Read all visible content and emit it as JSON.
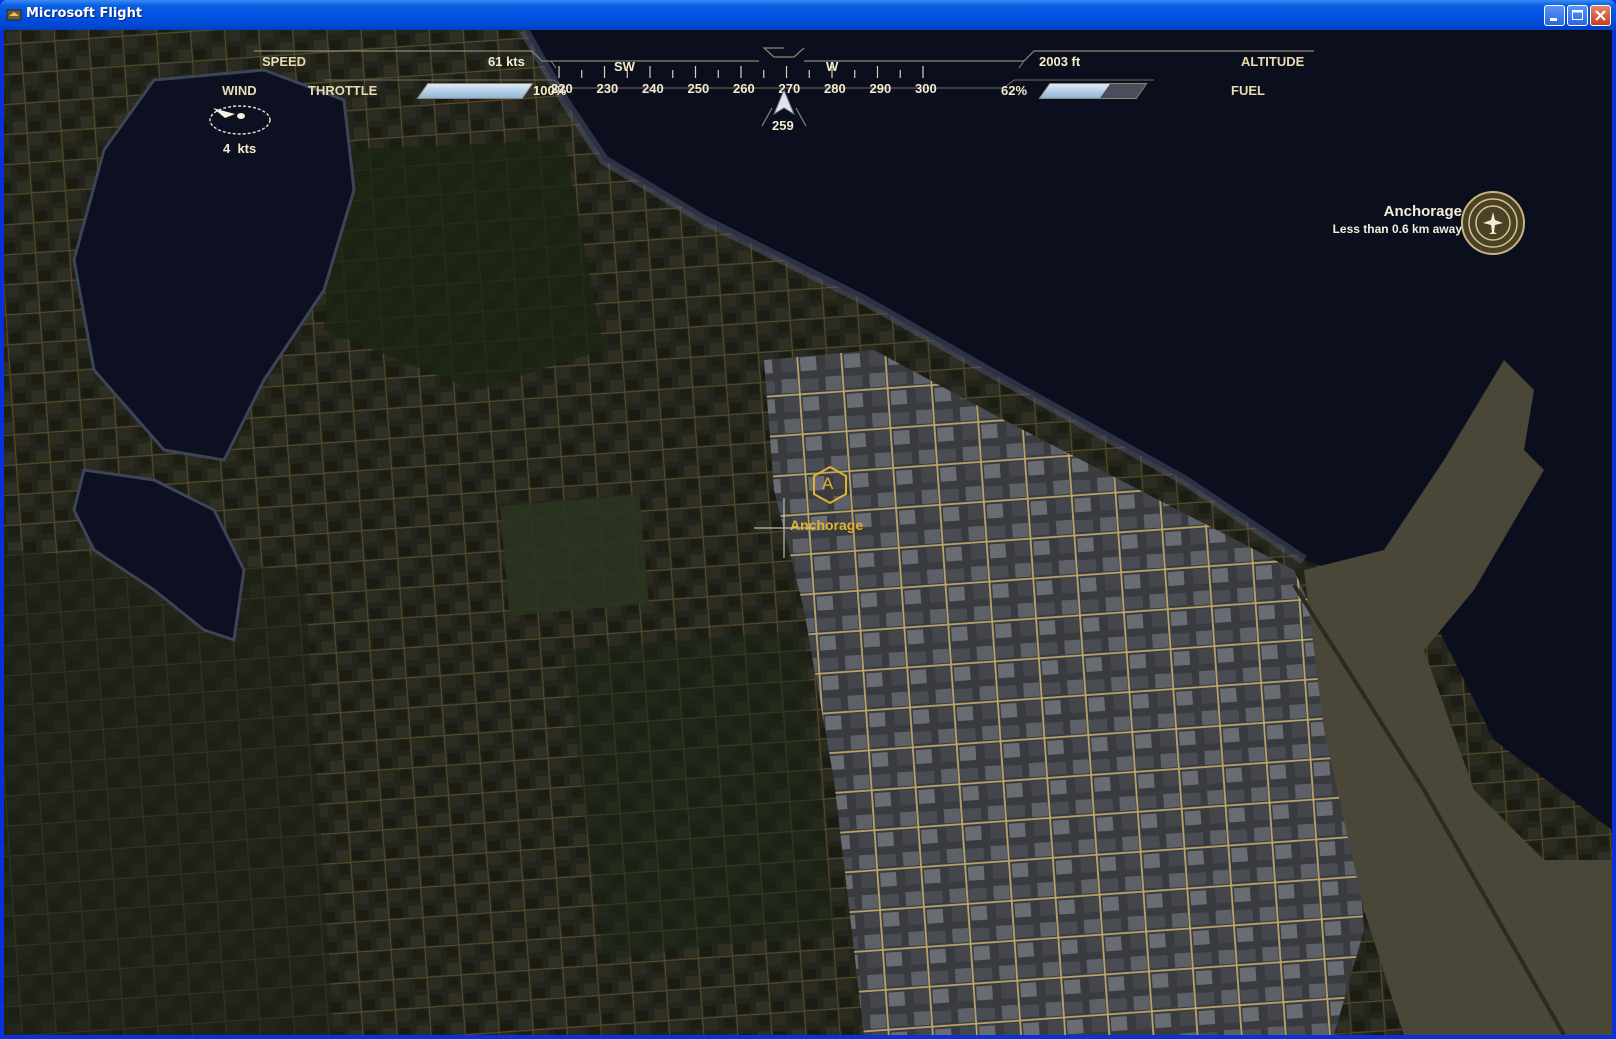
{
  "window": {
    "title": "Microsoft Flight"
  },
  "hud": {
    "speed": {
      "label": "SPEED",
      "value": "61 kts"
    },
    "throttle": {
      "label": "THROTTLE",
      "value": "100%",
      "level": 1.0
    },
    "wind": {
      "label": "WIND",
      "value": "4  kts"
    },
    "altitude": {
      "label": "ALTITUDE",
      "value": "2003 ft"
    },
    "fuel": {
      "label": "FUEL",
      "value": "62%",
      "level": 0.62
    },
    "compass": {
      "cardinals": [
        {
          "text": "SW"
        },
        {
          "text": "W"
        }
      ],
      "ticks": [
        "220",
        "230",
        "240",
        "250",
        "260",
        "270",
        "280",
        "290",
        "300"
      ],
      "heading": "259"
    }
  },
  "destination": {
    "name": "Anchorage",
    "distance": "Less than 0.6 km away"
  },
  "map_marker": {
    "letter": "A",
    "label": "Anchorage"
  },
  "colors": {
    "hud_text": "#e8dcb0",
    "marker": "#e3b12f",
    "water": "#0a0d1a",
    "titlebar": "#0054e3"
  }
}
